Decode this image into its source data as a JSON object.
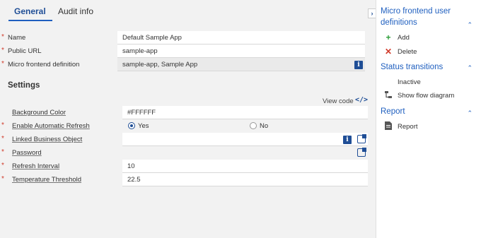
{
  "tabs": {
    "general": "General",
    "audit": "Audit info"
  },
  "fields": {
    "name": {
      "label": "Name",
      "value": "Default Sample App"
    },
    "public_url": {
      "label": "Public URL",
      "value": "sample-app"
    },
    "mf_definition": {
      "label": "Micro frontend definition",
      "value": "sample-app, Sample App"
    }
  },
  "settings": {
    "title": "Settings",
    "view_code": "View code",
    "view_code_icon": "</>",
    "background_color": {
      "label": "Background Color",
      "value": "#FFFFFF"
    },
    "auto_refresh": {
      "label": "Enable Automatic Refresh",
      "yes": "Yes",
      "no": "No",
      "selected": "Yes"
    },
    "linked_bo": {
      "label": "Linked Business Object",
      "value": ""
    },
    "password": {
      "label": "Password",
      "value": ""
    },
    "refresh_interval": {
      "label": "Refresh Interval",
      "value": "10"
    },
    "temperature_threshold": {
      "label": "Temperature Threshold",
      "value": "22.5"
    }
  },
  "sidebar": {
    "collapse_glyph": "›",
    "sections": [
      {
        "title": "Micro frontend user definitions",
        "title_line1": "Micro frontend user",
        "title_line2": "definitions",
        "actions": [
          {
            "label": "Add",
            "icon": "plus-icon"
          },
          {
            "label": "Delete",
            "icon": "x-icon"
          }
        ]
      },
      {
        "title": "Status transitions",
        "actions": [
          {
            "label": "Inactive",
            "icon": ""
          },
          {
            "label": "Show flow diagram",
            "icon": "flow-diagram-icon"
          }
        ]
      },
      {
        "title": "Report",
        "actions": [
          {
            "label": "Report",
            "icon": "document-icon"
          }
        ]
      }
    ]
  },
  "colors": {
    "accent": "#1f4e96",
    "link": "#1f5fbf",
    "required": "#d03a2a",
    "add": "#2e9e3a",
    "delete": "#d03a2a"
  },
  "required_mark": "*"
}
